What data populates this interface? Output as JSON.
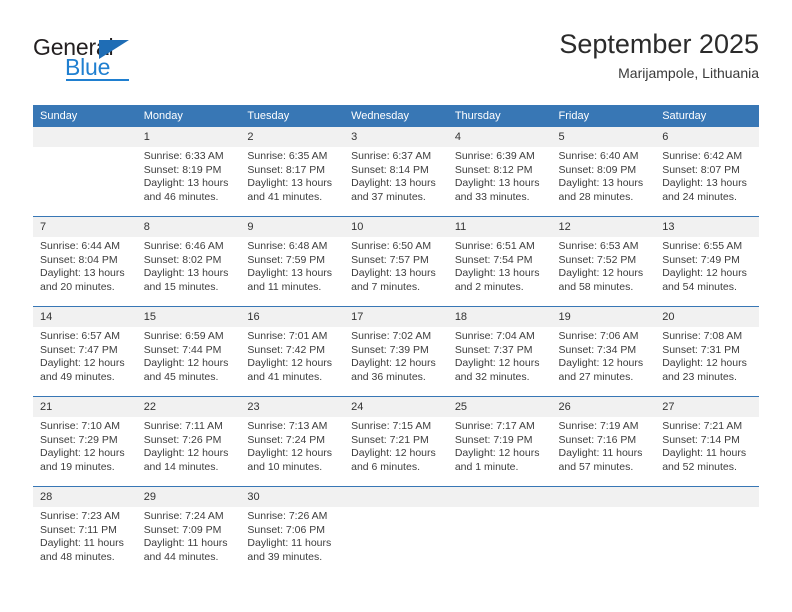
{
  "brand": {
    "name_part1": "General",
    "name_part2": "Blue",
    "logo_colors": {
      "text": "#231f20",
      "blue": "#1f7fd0",
      "triangle": "#1f6db5"
    }
  },
  "header": {
    "title": "September 2025",
    "subtitle": "Marijampole, Lithuania"
  },
  "theme": {
    "header_bg": "#3877b5",
    "header_text": "#ffffff",
    "daynum_bg": "#f1f1f1",
    "cell_bg": "#ffffff",
    "row_divider": "#3877b5"
  },
  "calendar": {
    "weekday_headers": [
      "Sunday",
      "Monday",
      "Tuesday",
      "Wednesday",
      "Thursday",
      "Friday",
      "Saturday"
    ],
    "weeks": [
      [
        {
          "day": "",
          "lines": []
        },
        {
          "day": "1",
          "lines": [
            "Sunrise: 6:33 AM",
            "Sunset: 8:19 PM",
            "Daylight: 13 hours",
            "and 46 minutes."
          ]
        },
        {
          "day": "2",
          "lines": [
            "Sunrise: 6:35 AM",
            "Sunset: 8:17 PM",
            "Daylight: 13 hours",
            "and 41 minutes."
          ]
        },
        {
          "day": "3",
          "lines": [
            "Sunrise: 6:37 AM",
            "Sunset: 8:14 PM",
            "Daylight: 13 hours",
            "and 37 minutes."
          ]
        },
        {
          "day": "4",
          "lines": [
            "Sunrise: 6:39 AM",
            "Sunset: 8:12 PM",
            "Daylight: 13 hours",
            "and 33 minutes."
          ]
        },
        {
          "day": "5",
          "lines": [
            "Sunrise: 6:40 AM",
            "Sunset: 8:09 PM",
            "Daylight: 13 hours",
            "and 28 minutes."
          ]
        },
        {
          "day": "6",
          "lines": [
            "Sunrise: 6:42 AM",
            "Sunset: 8:07 PM",
            "Daylight: 13 hours",
            "and 24 minutes."
          ]
        }
      ],
      [
        {
          "day": "7",
          "lines": [
            "Sunrise: 6:44 AM",
            "Sunset: 8:04 PM",
            "Daylight: 13 hours",
            "and 20 minutes."
          ]
        },
        {
          "day": "8",
          "lines": [
            "Sunrise: 6:46 AM",
            "Sunset: 8:02 PM",
            "Daylight: 13 hours",
            "and 15 minutes."
          ]
        },
        {
          "day": "9",
          "lines": [
            "Sunrise: 6:48 AM",
            "Sunset: 7:59 PM",
            "Daylight: 13 hours",
            "and 11 minutes."
          ]
        },
        {
          "day": "10",
          "lines": [
            "Sunrise: 6:50 AM",
            "Sunset: 7:57 PM",
            "Daylight: 13 hours",
            "and 7 minutes."
          ]
        },
        {
          "day": "11",
          "lines": [
            "Sunrise: 6:51 AM",
            "Sunset: 7:54 PM",
            "Daylight: 13 hours",
            "and 2 minutes."
          ]
        },
        {
          "day": "12",
          "lines": [
            "Sunrise: 6:53 AM",
            "Sunset: 7:52 PM",
            "Daylight: 12 hours",
            "and 58 minutes."
          ]
        },
        {
          "day": "13",
          "lines": [
            "Sunrise: 6:55 AM",
            "Sunset: 7:49 PM",
            "Daylight: 12 hours",
            "and 54 minutes."
          ]
        }
      ],
      [
        {
          "day": "14",
          "lines": [
            "Sunrise: 6:57 AM",
            "Sunset: 7:47 PM",
            "Daylight: 12 hours",
            "and 49 minutes."
          ]
        },
        {
          "day": "15",
          "lines": [
            "Sunrise: 6:59 AM",
            "Sunset: 7:44 PM",
            "Daylight: 12 hours",
            "and 45 minutes."
          ]
        },
        {
          "day": "16",
          "lines": [
            "Sunrise: 7:01 AM",
            "Sunset: 7:42 PM",
            "Daylight: 12 hours",
            "and 41 minutes."
          ]
        },
        {
          "day": "17",
          "lines": [
            "Sunrise: 7:02 AM",
            "Sunset: 7:39 PM",
            "Daylight: 12 hours",
            "and 36 minutes."
          ]
        },
        {
          "day": "18",
          "lines": [
            "Sunrise: 7:04 AM",
            "Sunset: 7:37 PM",
            "Daylight: 12 hours",
            "and 32 minutes."
          ]
        },
        {
          "day": "19",
          "lines": [
            "Sunrise: 7:06 AM",
            "Sunset: 7:34 PM",
            "Daylight: 12 hours",
            "and 27 minutes."
          ]
        },
        {
          "day": "20",
          "lines": [
            "Sunrise: 7:08 AM",
            "Sunset: 7:31 PM",
            "Daylight: 12 hours",
            "and 23 minutes."
          ]
        }
      ],
      [
        {
          "day": "21",
          "lines": [
            "Sunrise: 7:10 AM",
            "Sunset: 7:29 PM",
            "Daylight: 12 hours",
            "and 19 minutes."
          ]
        },
        {
          "day": "22",
          "lines": [
            "Sunrise: 7:11 AM",
            "Sunset: 7:26 PM",
            "Daylight: 12 hours",
            "and 14 minutes."
          ]
        },
        {
          "day": "23",
          "lines": [
            "Sunrise: 7:13 AM",
            "Sunset: 7:24 PM",
            "Daylight: 12 hours",
            "and 10 minutes."
          ]
        },
        {
          "day": "24",
          "lines": [
            "Sunrise: 7:15 AM",
            "Sunset: 7:21 PM",
            "Daylight: 12 hours",
            "and 6 minutes."
          ]
        },
        {
          "day": "25",
          "lines": [
            "Sunrise: 7:17 AM",
            "Sunset: 7:19 PM",
            "Daylight: 12 hours",
            "and 1 minute."
          ]
        },
        {
          "day": "26",
          "lines": [
            "Sunrise: 7:19 AM",
            "Sunset: 7:16 PM",
            "Daylight: 11 hours",
            "and 57 minutes."
          ]
        },
        {
          "day": "27",
          "lines": [
            "Sunrise: 7:21 AM",
            "Sunset: 7:14 PM",
            "Daylight: 11 hours",
            "and 52 minutes."
          ]
        }
      ],
      [
        {
          "day": "28",
          "lines": [
            "Sunrise: 7:23 AM",
            "Sunset: 7:11 PM",
            "Daylight: 11 hours",
            "and 48 minutes."
          ]
        },
        {
          "day": "29",
          "lines": [
            "Sunrise: 7:24 AM",
            "Sunset: 7:09 PM",
            "Daylight: 11 hours",
            "and 44 minutes."
          ]
        },
        {
          "day": "30",
          "lines": [
            "Sunrise: 7:26 AM",
            "Sunset: 7:06 PM",
            "Daylight: 11 hours",
            "and 39 minutes."
          ]
        },
        {
          "day": "",
          "lines": []
        },
        {
          "day": "",
          "lines": []
        },
        {
          "day": "",
          "lines": []
        },
        {
          "day": "",
          "lines": []
        }
      ]
    ]
  }
}
